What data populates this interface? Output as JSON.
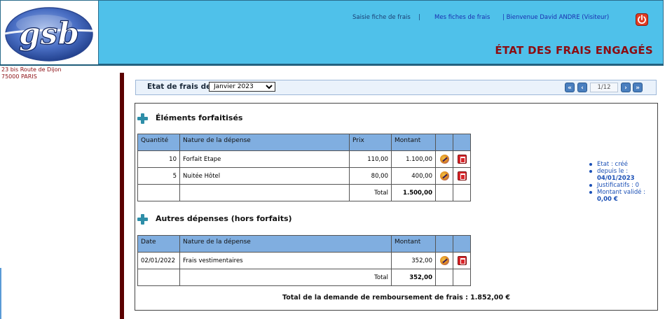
{
  "header": {
    "nav": {
      "saisie_label": "Saisie fiche de frais",
      "separator": "|",
      "mes_fiches_label": "Mes fiches de frais",
      "welcome": "| Bienvenue David ANDRE (Visiteur)"
    },
    "logo_text": "gsb",
    "page_title": "ÉTAT DES FRAIS ENGAGÉS",
    "logout_icon": "power-icon"
  },
  "address": {
    "line1": "23 bis Route de Dijon",
    "line2": "75000 PARIS"
  },
  "month_bar": {
    "label": "Etat de frais de",
    "selected_month": "Janvier 2023",
    "pager_value": "1/12",
    "first_label": "«",
    "prev_label": "‹",
    "next_label": "›",
    "last_label": "»"
  },
  "forfait": {
    "title": "Éléments forfaitisés",
    "headers": {
      "quantite": "Quantité",
      "nature": "Nature de la dépense",
      "prix": "Prix",
      "montant": "Montant"
    },
    "rows": [
      {
        "quantite": "10",
        "nature": "Forfait Etape",
        "prix": "110,00",
        "montant": "1.100,00"
      },
      {
        "quantite": "5",
        "nature": "Nuitée Hôtel",
        "prix": "80,00",
        "montant": "400,00"
      }
    ],
    "total_label": "Total",
    "total_value": "1.500,00"
  },
  "hors_forfait": {
    "title": "Autres dépenses (hors forfaits)",
    "headers": {
      "date": "Date",
      "nature": "Nature de la dépense",
      "montant": "Montant"
    },
    "rows": [
      {
        "date": "02/01/2022",
        "nature": "Frais vestimentaires",
        "montant": "352,00"
      }
    ],
    "total_label": "Total",
    "total_value": "352,00"
  },
  "grand_total": "Total de la demande de remboursement de frais : 1.852,00 €",
  "status": {
    "etat_label": "Etat : ",
    "etat_value": "créé",
    "depuis_label": "depuis le :",
    "depuis_value": "04/01/2023",
    "justificatifs_label": "Justificatifs : ",
    "justificatifs_value": "0",
    "montant_label": "Montant validé :",
    "montant_value": "0,00 €"
  },
  "colors": {
    "header_bg": "#4fc1ea",
    "title": "#8b0d12",
    "table_header": "#80aee0"
  }
}
